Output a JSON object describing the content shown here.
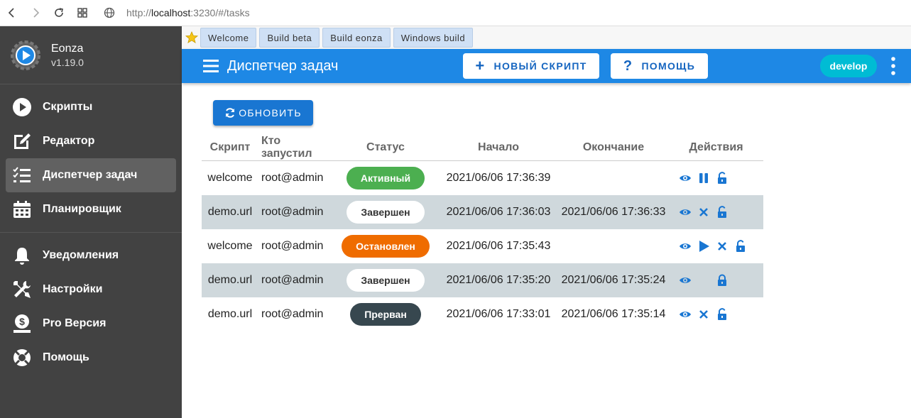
{
  "browser": {
    "url_prefix": "http://",
    "url_host": "localhost",
    "url_rest": ":3230/#/tasks"
  },
  "app": {
    "name": "Eonza",
    "version": "v1.19.0"
  },
  "sidebar": {
    "items": [
      {
        "label": "Скрипты",
        "icon": "play-circle-icon"
      },
      {
        "label": "Редактор",
        "icon": "edit-icon"
      },
      {
        "label": "Диспетчер задач",
        "icon": "list-check-icon",
        "active": true
      },
      {
        "label": "Планировщик",
        "icon": "calendar-icon"
      },
      {
        "label": "Уведомления",
        "icon": "bell-icon"
      },
      {
        "label": "Настройки",
        "icon": "tools-icon"
      },
      {
        "label": "Pro Версия",
        "icon": "dollar-icon"
      },
      {
        "label": "Помощь",
        "icon": "lifebuoy-icon"
      }
    ]
  },
  "bookmarks": [
    "Welcome",
    "Build beta",
    "Build eonza",
    "Windows build"
  ],
  "appbar": {
    "title": "Диспетчер задач",
    "new_script": "НОВЫЙ СКРИПТ",
    "help": "ПОМОЩЬ",
    "branch": "develop"
  },
  "refresh_label": "ОБНОВИТЬ",
  "table": {
    "headers": [
      "Скрипт",
      "Кто запустил",
      "Статус",
      "Начало",
      "Окончание",
      "Действия"
    ],
    "rows": [
      {
        "script": "welcome",
        "user": "root@admin",
        "status": "Активный",
        "start": "2021/06/06 17:36:39",
        "end": ""
      },
      {
        "script": "demo.url",
        "user": "root@admin",
        "status": "Завершен",
        "start": "2021/06/06 17:36:03",
        "end": "2021/06/06 17:36:33"
      },
      {
        "script": "welcome",
        "user": "root@admin",
        "status": "Остановлен",
        "start": "2021/06/06 17:35:43",
        "end": ""
      },
      {
        "script": "demo.url",
        "user": "root@admin",
        "status": "Завершен",
        "start": "2021/06/06 17:35:20",
        "end": "2021/06/06 17:35:24"
      },
      {
        "script": "demo.url",
        "user": "root@admin",
        "status": "Прерван",
        "start": "2021/06/06 17:33:01",
        "end": "2021/06/06 17:35:14"
      }
    ]
  },
  "colors": {
    "primary": "#1e88e5",
    "sidebar": "#424242",
    "active": "#4caf50",
    "stopped": "#ef6c00",
    "aborted": "#37474f",
    "chip": "#00bcd4"
  }
}
